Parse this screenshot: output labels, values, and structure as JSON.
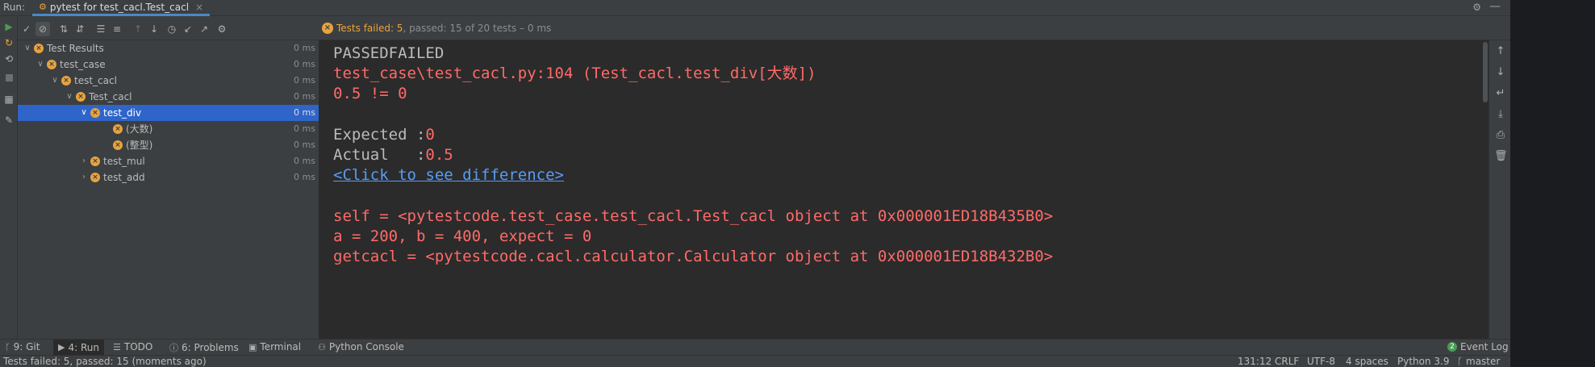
{
  "colors": {
    "accent": "#2f65ca",
    "failed": "#e8a33e",
    "error_text": "#ff6b68",
    "link": "#589df6",
    "panel": "#3c3f41",
    "console_bg": "#2b2b2b"
  },
  "tabbar": {
    "run_label": "Run:",
    "tab_label": "pytest for test_cacl.Test_cacl",
    "tab_close": "×",
    "gear": "⚙",
    "minimize": "—"
  },
  "status": {
    "failed_text": "Tests failed: 5",
    "rest_text": ", passed: 15 of 20 tests – 0 ms"
  },
  "tree": {
    "root_label": "Test Results",
    "rows": [
      {
        "label": "Test Results",
        "time": "0 ms"
      },
      {
        "label": "test_case",
        "time": "0 ms"
      },
      {
        "label": "test_cacl",
        "time": "0 ms"
      },
      {
        "label": "Test_cacl",
        "time": "0 ms"
      },
      {
        "label": "test_div",
        "time": "0 ms"
      },
      {
        "label": "(大数)",
        "time": "0 ms"
      },
      {
        "label": "(整型)",
        "time": "0 ms"
      },
      {
        "label": "test_mul",
        "time": "0 ms"
      },
      {
        "label": "test_add",
        "time": "0 ms"
      }
    ]
  },
  "console": {
    "lines": [
      "PASSEDFAILED",
      "test_case\\test_cacl.py:104 (Test_cacl.test_div[大数])",
      "0.5 != 0",
      "",
      "Expected :0",
      "Actual   :0.5",
      "<Click to see difference>",
      "",
      "self = <pytestcode.test_case.test_cacl.Test_cacl object at 0x000001ED18B435B0>",
      "a = 200, b = 400, expect = 0",
      "getcacl = <pytestcode.cacl.calculator.Calculator object at 0x000001ED18B432B0>"
    ],
    "expected_label": "Expected :",
    "expected_value": "0",
    "actual_label": "Actual   :",
    "actual_value": "0.5"
  },
  "bottom_tools": {
    "git": "9: Git",
    "run": "4: Run",
    "todo": "TODO",
    "problems": "6: Problems",
    "terminal": "Terminal",
    "python_console": "Python Console",
    "event_log": "Event Log",
    "event_log_count": "2"
  },
  "statusbar": {
    "message": "Tests failed: 5, passed: 15 (moments ago)",
    "position": "131:12",
    "line_sep": "CRLF",
    "encoding": "UTF-8",
    "indent": "4 spaces",
    "interpreter": "Python 3.9",
    "branch": "master"
  },
  "icons": {
    "run": "play-icon",
    "rerun_failed": "rerun-failed-icon",
    "stop": "stop-icon",
    "layout": "layout-icon",
    "pin": "pin-icon",
    "check": "show-passed-icon",
    "ignored": "show-ignored-icon",
    "sort_alpha": "sort-alpha-icon",
    "sort_duration": "sort-duration-icon",
    "expand_all": "expand-all-icon",
    "collapse_all": "collapse-all-icon",
    "prev_fail": "previous-failed-icon",
    "next_fail": "next-failed-icon",
    "history": "history-icon",
    "import": "import-icon",
    "export": "export-icon",
    "settings": "settings-icon"
  }
}
